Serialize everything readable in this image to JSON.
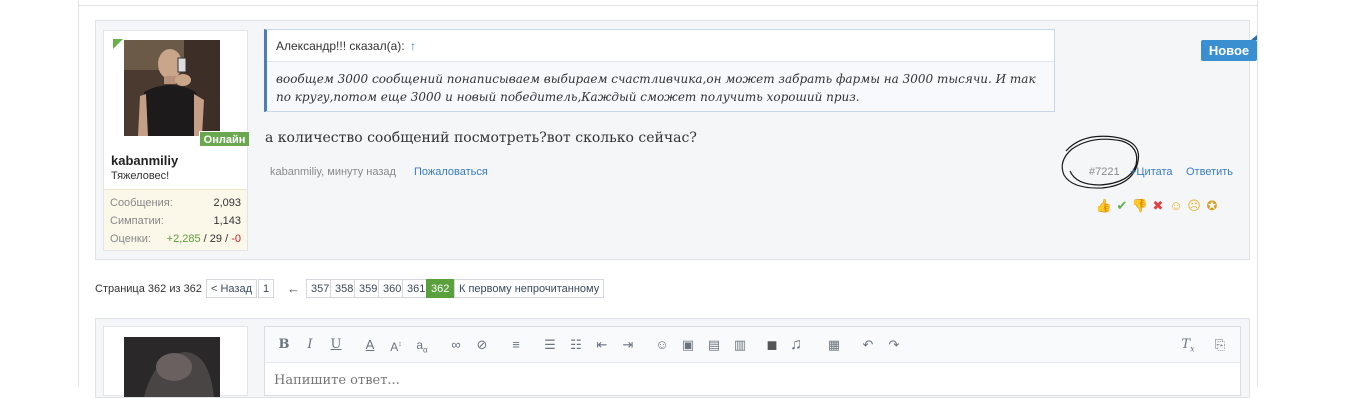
{
  "post": {
    "user": {
      "name": "kabanmiliy",
      "title": "Тяжеловес!",
      "online_label": "Онлайн",
      "stats": [
        {
          "label": "Сообщения:",
          "value": "2,093"
        },
        {
          "label": "Симпатии:",
          "value": "1,143"
        }
      ],
      "ratings": {
        "label": "Оценки:",
        "positive": "+2,285",
        "sep1": " / ",
        "neutral": "29",
        "sep2": " / ",
        "negative": "-0"
      }
    },
    "quote": {
      "author": "Александр!!! сказал(а):",
      "arrow": "↑",
      "text": "вообщем 3000 сообщений понаписываем выбираем счастливчика,он может забрать фармы на 3000 тысячи. И так по кругу,потом еще 3000 и новый победитель,Каждый сможет получить хороший приз."
    },
    "message": "а количество сообщений посмотреть?вот сколько сейчас?",
    "meta": {
      "author_time": "kabanmiliy, минуту назад",
      "report": "Пожаловаться"
    },
    "post_number": "#7221",
    "quote_link": "+Цитата",
    "reply_link": "Ответить",
    "new_badge": "Новое",
    "reactions": [
      "thumbs-up",
      "check",
      "thumbs-down",
      "cross",
      "smile",
      "sad",
      "medal"
    ]
  },
  "pagination": {
    "status": "Страница 362 из 362",
    "prev": "< Назад",
    "first": "1",
    "arrow": "←",
    "pages": [
      "357",
      "358",
      "359",
      "360",
      "361",
      "362"
    ],
    "current": "362",
    "unread": "К первому непрочитанному"
  },
  "editor": {
    "placeholder": "Напишите ответ...",
    "toolbar": [
      "bold",
      "italic",
      "underline",
      "font-color",
      "font-size",
      "font-family",
      "link",
      "unlink",
      "align",
      "list-bulleted",
      "list-numbered",
      "outdent",
      "indent",
      "smilies",
      "image",
      "media",
      "code",
      "quote",
      "audio",
      "save",
      "undo",
      "redo",
      "remove-format",
      "preview"
    ]
  },
  "colors": {
    "online": "#6aa84f",
    "new_badge": "#3a8fd0",
    "link": "#3a7cc0",
    "active_page": "#5aa03c"
  }
}
